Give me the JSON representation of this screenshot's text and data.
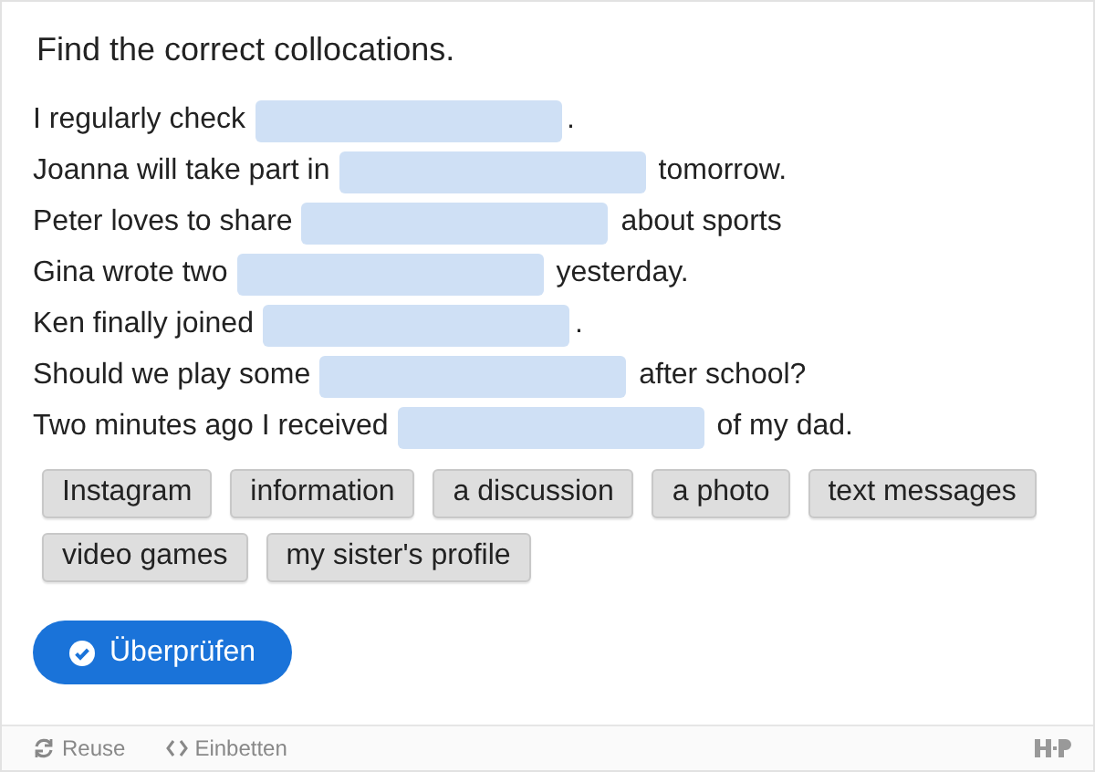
{
  "title": "Find the correct collocations.",
  "sentences": [
    {
      "before": "I regularly check",
      "after": "."
    },
    {
      "before": "Joanna will take part in",
      "after": "tomorrow."
    },
    {
      "before": "Peter loves to share",
      "after": "about sports"
    },
    {
      "before": "Gina wrote two",
      "after": "yesterday."
    },
    {
      "before": "Ken finally joined",
      "after": "."
    },
    {
      "before": "Should we play some",
      "after": "after school?"
    },
    {
      "before": "Two minutes ago I received",
      "after": "of my dad."
    }
  ],
  "words": [
    "Instagram",
    "information",
    "a discussion",
    "a photo",
    "text messages",
    "video games",
    "my sister's profile"
  ],
  "check_button": "Überprüfen",
  "footer": {
    "reuse": "Reuse",
    "embed": "Einbetten"
  }
}
